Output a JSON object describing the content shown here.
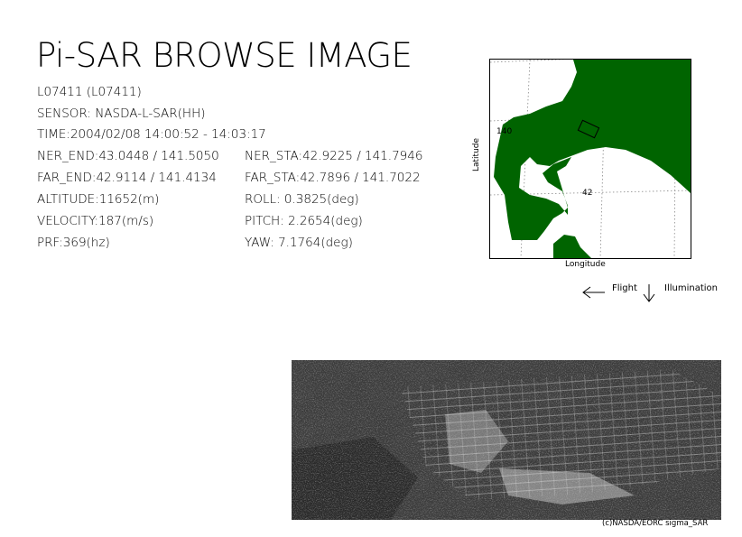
{
  "title": "Pi-SAR BROWSE IMAGE",
  "info": {
    "scene_id": "L07411 (L07411)",
    "sensor": "SENSOR: NASDA-L-SAR(HH)",
    "time": "TIME:2004/02/08  14:00:52 - 14:03:17",
    "ner_end": "NER_END:43.0448 / 141.5050",
    "ner_sta": "NER_STA:42.9225 / 141.7946",
    "far_end": "FAR_END:42.9114 / 141.4134",
    "far_sta": "FAR_STA:42.7896 / 141.7022",
    "altitude": "ALTITUDE:11652(m)",
    "roll": "ROLL: 0.3825(deg)",
    "velocity": "VELOCITY:187(m/s)",
    "pitch": "PITCH:  2.2654(deg)",
    "prf": "PRF:369(hz)",
    "yaw": "YAW:   7.1764(deg)"
  },
  "map": {
    "lon_grid_label": "140",
    "lat_grid_label": "42",
    "y_axis_label": "Latitude",
    "x_axis_label": "Longitude",
    "land_color": "#006400"
  },
  "legend": {
    "flight_label": "Flight",
    "illumination_label": "Illumination",
    "flight_icon": "left-arrow-icon",
    "illumination_icon": "down-arrow-icon"
  },
  "credit": "(c)NASDA/EORC sigma_SAR"
}
